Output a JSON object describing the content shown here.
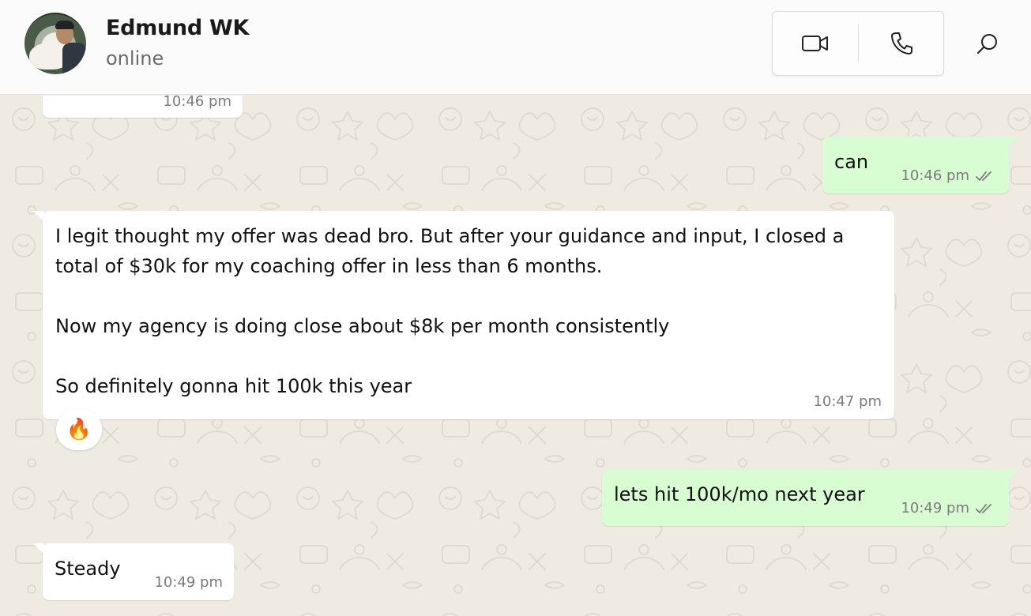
{
  "header": {
    "contact_name": "Edmund WK",
    "status": "online",
    "video_call_icon": "video-camera-icon",
    "voice_call_icon": "phone-icon",
    "search_icon": "search-icon"
  },
  "messages": [
    {
      "direction": "incoming",
      "text": "",
      "time": "10:46 pm"
    },
    {
      "direction": "outgoing",
      "text": "can",
      "time": "10:46 pm",
      "status": "read"
    },
    {
      "direction": "incoming",
      "text": "I legit thought my offer was dead bro. But after your guidance and input, I closed a total of $30k for my coaching offer in less than 6 months.\n\nNow my agency is doing close about $8k per month consistently\n\nSo definitely gonna hit 100k this year",
      "time": "10:47 pm",
      "reaction": "🔥"
    },
    {
      "direction": "outgoing",
      "text": "lets hit 100k/mo next year",
      "time": "10:49 pm",
      "status": "read"
    },
    {
      "direction": "incoming",
      "text": "Steady",
      "time": "10:49 pm"
    }
  ],
  "colors": {
    "incoming_bubble": "#ffffff",
    "outgoing_bubble": "#d9fdd3",
    "wallpaper": "#efeae2",
    "read_tick": "#7b7b7b"
  }
}
